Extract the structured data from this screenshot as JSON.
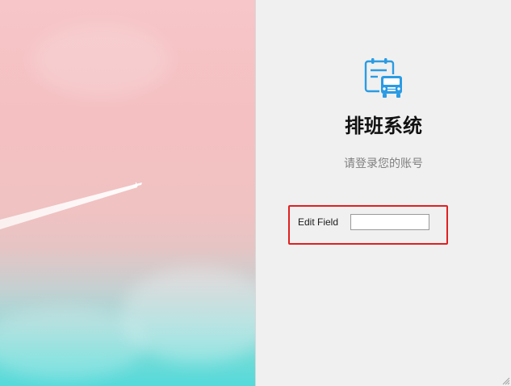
{
  "app": {
    "title": "排班系统",
    "subtitle": "请登录您的账号"
  },
  "form": {
    "label": "Edit Field",
    "value": "",
    "placeholder": ""
  },
  "icons": {
    "logo": "schedule-bus-icon",
    "resize": "resize-grip-icon"
  },
  "colors": {
    "logo_blue": "#2b9be3",
    "highlight_red": "#e02020",
    "panel_bg": "#f0f0f0"
  }
}
